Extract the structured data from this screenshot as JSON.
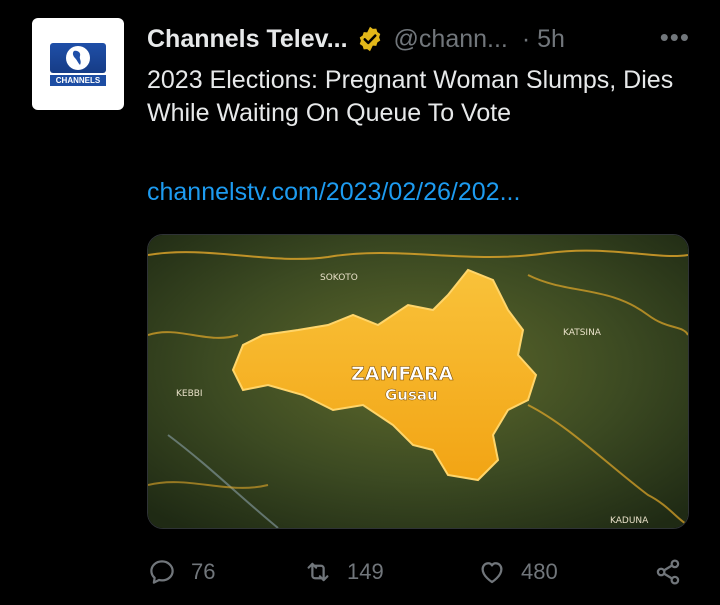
{
  "account": {
    "display_name": "Channels Telev...",
    "handle": "@chann...",
    "time": "· 5h",
    "more_label": "•••",
    "avatar_text": "CHANNELS"
  },
  "tweet": {
    "text": "2023 Elections: Pregnant Woman Slumps, Dies While Waiting On Queue To Vote",
    "link": "channelstv.com/2023/02/26/202..."
  },
  "map": {
    "title": "ZAMFARA",
    "capital": "Gusau",
    "labels": {
      "sokoto": "SOKOTO",
      "katsina": "KATSINA",
      "kebbi": "KEBBI",
      "kaduna": "KADUNA"
    }
  },
  "metrics": {
    "replies": "76",
    "reposts": "149",
    "likes": "480"
  },
  "colors": {
    "accent_link": "#1d9bf0",
    "verified_gold": "#e2b719",
    "muted": "#71767b",
    "map_highlight": "#f5b21d"
  },
  "icons": [
    "reply-icon",
    "repost-icon",
    "like-icon",
    "share-icon",
    "verified-icon",
    "more-icon"
  ]
}
